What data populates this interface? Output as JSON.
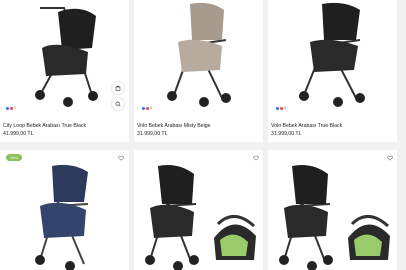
{
  "products": [
    {
      "title": "City Loop Bebek Arabası True Black",
      "price": "41.999,00 TL",
      "badge": "",
      "color_count": "1",
      "color": "#2a2a2a"
    },
    {
      "title": "Volo Bebek Arabası Misty Beige",
      "price": "31.999,00 TL",
      "badge": "",
      "color_count": "4",
      "color": "#a89a8c"
    },
    {
      "title": "Volo Bebek Arabası True Black",
      "price": "31.999,00 TL",
      "badge": "",
      "color_count": "4",
      "color": "#2a2a2a"
    },
    {
      "title": "",
      "price": "",
      "badge": "Yeni",
      "color_count": "",
      "color": "#2c3a5c"
    },
    {
      "title": "",
      "price": "",
      "badge": "",
      "color_count": "",
      "color": "#2a2a2a"
    },
    {
      "title": "",
      "price": "",
      "badge": "",
      "color_count": "",
      "color": "#2a2a2a"
    }
  ],
  "colors": {
    "accent": "#8dbf5a",
    "background": "#f1f1f1",
    "card": "#ffffff",
    "text": "#222222"
  }
}
